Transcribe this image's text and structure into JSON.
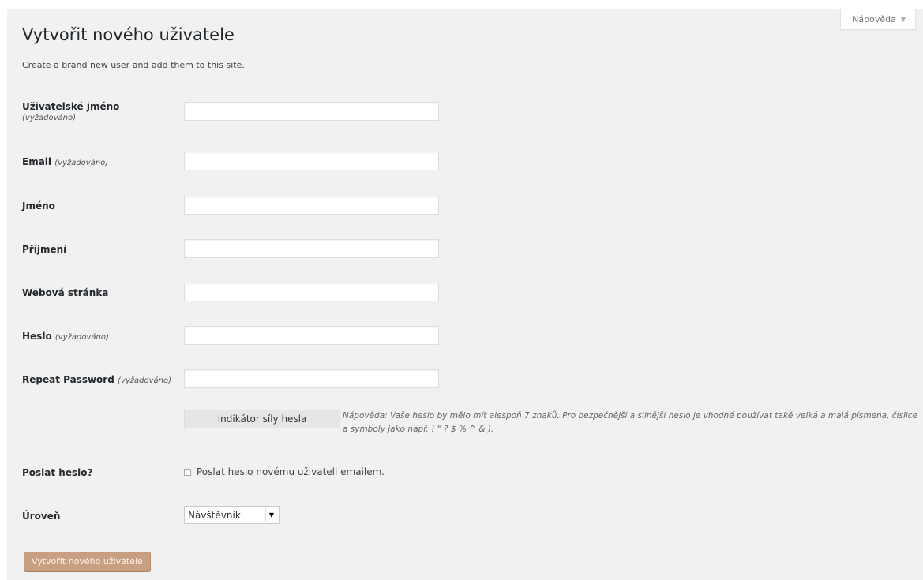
{
  "help_tab": {
    "label": "Nápověda"
  },
  "page": {
    "title": "Vytvořit nového uživatele",
    "intro": "Create a brand new user and add them to this site."
  },
  "fields": {
    "username": {
      "label": "Uživatelské jméno",
      "note": "(vyžadováno)",
      "value": ""
    },
    "email": {
      "label": "Email",
      "note": "(vyžadováno)",
      "value": ""
    },
    "first_name": {
      "label": "Jméno",
      "value": ""
    },
    "last_name": {
      "label": "Příjmení",
      "value": ""
    },
    "website": {
      "label": "Webová stránka",
      "value": ""
    },
    "password": {
      "label": "Heslo",
      "note": "(vyžadováno)",
      "value": ""
    },
    "repeat_password": {
      "label": "Repeat Password",
      "note": "(vyžadováno)",
      "value": ""
    }
  },
  "strength": {
    "label": "Indikátor síly hesla",
    "hint": "Nápověda: Vaše heslo by mělo mít alespoň 7 znaků. Pro bezpečnější a silnější heslo je vhodné používat také velká a malá písmena, číslice a symboly jako např. ! \" ? $ % ^ & )."
  },
  "send_password": {
    "label": "Poslat heslo?",
    "checkbox_label": "Poslat heslo novému uživateli emailem.",
    "checked": false
  },
  "role": {
    "label": "Úroveň",
    "selected": "Návštěvník"
  },
  "submit": {
    "label": "Vytvořit nového uživatele"
  },
  "colors": {
    "background": "#f1f1f1",
    "submit_bg": "#c89f80"
  }
}
